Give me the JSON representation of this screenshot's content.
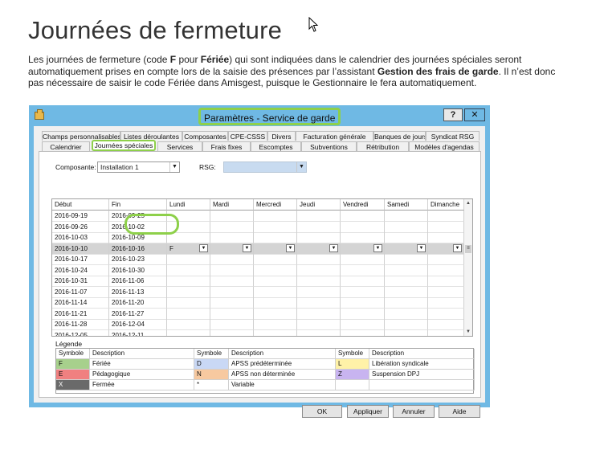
{
  "page": {
    "title": "Journées de fermeture",
    "intro": {
      "p1": "Les journées de fermeture (code ",
      "code": "F",
      "p2": " pour ",
      "fer": "Fériée",
      "p3": ") qui sont indiquées dans le calendrier des journées spéciales seront automatiquement prises en compte lors de la saisie des présences par l’assistant ",
      "assistant": "Gestion des frais de garde",
      "p4": ". Il n’est donc pas nécessaire de saisir le code Fériée dans Amisgest, puisque le Gestionnaire le fera automatiquement."
    }
  },
  "dialog": {
    "title": "Paramètres - Service de garde",
    "help": "?",
    "close": "✕",
    "tabs_row1": [
      "Champs personnalisables",
      "Listes déroulantes",
      "Composantes",
      "CPE-CSSS",
      "Divers",
      "Facturation générale",
      "Banques de jours",
      "Syndicat RSG"
    ],
    "tabs_row2": [
      "Calendrier",
      "Journées spéciales",
      "Services",
      "Frais fixes",
      "Escomptes",
      "Subventions",
      "Rétribution",
      "Modèles d'agendas"
    ],
    "composante_label": "Composante:",
    "composante_value": "Installation 1",
    "rsg_label": "RSG:",
    "rsg_value": "",
    "grid": {
      "columns": [
        "Début",
        "Fin",
        "Lundi",
        "Mardi",
        "Mercredi",
        "Jeudi",
        "Vendredi",
        "Samedi",
        "Dimanche"
      ],
      "rows": [
        [
          "2016-09-19",
          "2016-09-25"
        ],
        [
          "2016-09-26",
          "2016-10-02"
        ],
        [
          "2016-10-03",
          "2016-10-09"
        ],
        [
          "2016-10-10",
          "2016-10-16"
        ],
        [
          "2016-10-17",
          "2016-10-23"
        ],
        [
          "2016-10-24",
          "2016-10-30"
        ],
        [
          "2016-10-31",
          "2016-11-06"
        ],
        [
          "2016-11-07",
          "2016-11-13"
        ],
        [
          "2016-11-14",
          "2016-11-20"
        ],
        [
          "2016-11-21",
          "2016-11-27"
        ],
        [
          "2016-11-28",
          "2016-12-04"
        ],
        [
          "2016-12-05",
          "2016-12-11"
        ]
      ],
      "selected_row": 3,
      "selected_monday_value": "F"
    },
    "legend": {
      "title": "Légende",
      "headers": [
        "Symbole",
        "Description",
        "Symbole",
        "Description",
        "Symbole",
        "Description"
      ],
      "rows": [
        [
          {
            "sym": "F",
            "color": "#a7d08c",
            "desc": "Fériée"
          },
          {
            "sym": "D",
            "color": "#c9d8f5",
            "desc": "APSS prédéterminée"
          },
          {
            "sym": "L",
            "color": "#fff2a8",
            "desc": "Libération syndicale"
          }
        ],
        [
          {
            "sym": "E",
            "color": "#f08080",
            "desc": "Pédagogique"
          },
          {
            "sym": "N",
            "color": "#f7c9a0",
            "desc": "APSS non déterminée"
          },
          {
            "sym": "Z",
            "color": "#c8b4f0",
            "desc": "Suspension DPJ"
          }
        ],
        [
          {
            "sym": "X",
            "color": "#6a6a6a",
            "desc": "Fermée"
          },
          {
            "sym": "*",
            "color": "#ffffff",
            "desc": "Variable"
          },
          {
            "sym": "",
            "color": "#ffffff",
            "desc": ""
          }
        ]
      ]
    },
    "buttons": {
      "ok": "OK",
      "apply": "Appliquer",
      "cancel": "Annuler",
      "help": "Aide"
    }
  },
  "colors": {
    "titlebar": "#6fb9e4",
    "highlight": "#8ed04a",
    "selected_row": "#d4d4d4",
    "rsg_disabled": "#c8dbf0"
  }
}
